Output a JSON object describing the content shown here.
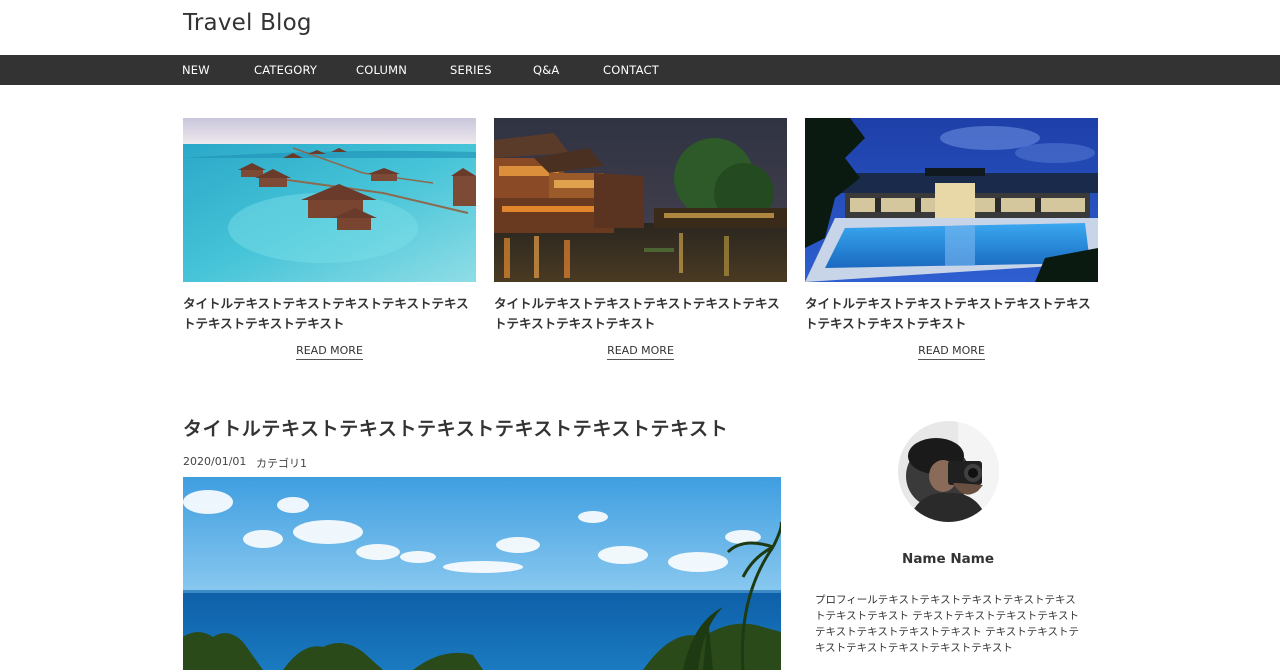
{
  "header": {
    "site_title": "Travel Blog"
  },
  "nav": {
    "items": [
      "NEW",
      "CATEGORY",
      "COLUMN",
      "SERIES",
      "Q&A",
      "CONTACT"
    ]
  },
  "featured": [
    {
      "image": "overwater-bungalows-photo",
      "title": "タイトルテキストテキストテキストテキストテキストテキストテキストテキスト",
      "read_more": "READ MORE"
    },
    {
      "image": "night-canal-town-photo",
      "title": "タイトルテキストテキストテキストテキストテキストテキストテキストテキスト",
      "read_more": "READ MORE"
    },
    {
      "image": "resort-pool-night-photo",
      "title": "タイトルテキストテキストテキストテキストテキストテキストテキストテキスト",
      "read_more": "READ MORE"
    }
  ],
  "post": {
    "title": "タイトルテキストテキストテキストテキストテキストテキスト",
    "date": "2020/01/01",
    "category": "カテゴリ1",
    "image": "tropical-sea-palms-photo"
  },
  "profile": {
    "avatar": "photographer-avatar",
    "name": "Name Name",
    "text": "プロフィールテキストテキストテキストテキストテキストテキストテキスト テキストテキストテキストテキストテキストテキストテキストテキスト テキストテキストテキストテキストテキストテキストテキスト"
  },
  "colors": {
    "nav_background": "#333333",
    "text": "#333333",
    "background": "#ffffff"
  }
}
